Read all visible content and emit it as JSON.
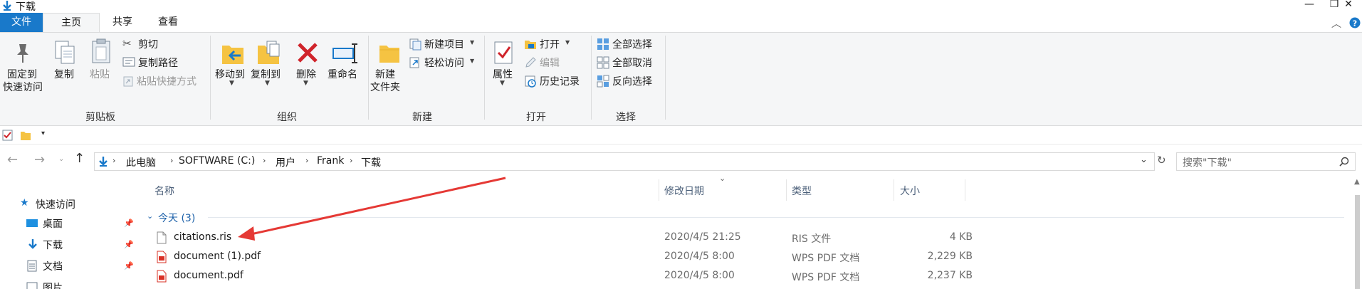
{
  "window": {
    "title": "下载",
    "minimize_glyph": "—",
    "restore_glyph": "❐",
    "close_glyph": "✕"
  },
  "tabs": [
    {
      "label": "文件"
    },
    {
      "label": "主页"
    },
    {
      "label": "共享"
    },
    {
      "label": "查看"
    }
  ],
  "ribbon": {
    "clipboard": {
      "group_label": "剪贴板",
      "pin_label_1": "固定到",
      "pin_label_2": "快速访问",
      "copy": "复制",
      "paste": "粘贴",
      "cut": "剪切",
      "copy_path": "复制路径",
      "paste_shortcut": "粘贴快捷方式"
    },
    "organize": {
      "group_label": "组织",
      "move_to": "移动到",
      "copy_to": "复制到",
      "delete": "删除",
      "rename": "重命名"
    },
    "new": {
      "group_label": "新建",
      "new_folder_1": "新建",
      "new_folder_2": "文件夹",
      "new_item": "新建项目",
      "easy_access": "轻松访问"
    },
    "open": {
      "group_label": "打开",
      "properties": "属性",
      "open": "打开",
      "edit": "编辑",
      "history": "历史记录"
    },
    "select": {
      "group_label": "选择",
      "select_all": "全部选择",
      "select_none": "全部取消",
      "invert": "反向选择"
    }
  },
  "address": {
    "crumbs": [
      "此电脑",
      "SOFTWARE (C:)",
      "用户",
      "Frank",
      "下载"
    ],
    "search_placeholder": "搜索\"下载\""
  },
  "nav": {
    "quick_access": "快速访问",
    "items": [
      {
        "label": "桌面"
      },
      {
        "label": "下载"
      },
      {
        "label": "文档"
      },
      {
        "label": "图片"
      }
    ]
  },
  "list": {
    "columns": {
      "name": "名称",
      "modified": "修改日期",
      "type": "类型",
      "size": "大小"
    },
    "group_header": "今天 (3)",
    "files": [
      {
        "name": "citations.ris",
        "modified": "2020/4/5 21:25",
        "type": "RIS 文件",
        "size": "4 KB"
      },
      {
        "name": "document (1).pdf",
        "modified": "2020/4/5 8:00",
        "type": "WPS PDF 文档",
        "size": "2,229 KB"
      },
      {
        "name": "document.pdf",
        "modified": "2020/4/5 8:00",
        "type": "WPS PDF 文档",
        "size": "2,237 KB"
      }
    ]
  },
  "colors": {
    "accent": "#1979ca",
    "annotation_arrow": "#e53935",
    "pdf_red": "#d93025",
    "folder_yellow": "#f5c342"
  }
}
